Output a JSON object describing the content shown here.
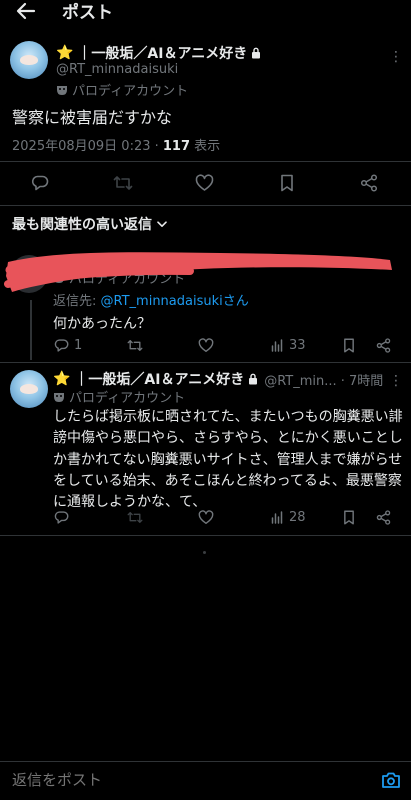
{
  "header": {
    "title": "ポスト",
    "back_icon": "arrow-left-icon"
  },
  "main_post": {
    "star": "⭐",
    "display_name": "｜一般垢／AI＆アニメ好き",
    "handle": "@RT_minnadaisuki",
    "label": "パロディアカウント",
    "text": "警察に被害届だすかな",
    "datetime": "2025年08月09日 0:23 · ",
    "views_count": "117",
    "views_label": " 表示"
  },
  "sort_label": "最も関連性の高い返信",
  "reply1": {
    "label": "パロディアカウント",
    "reply_to_prefix": "返信先: ",
    "reply_to_handle": "@RT_minnadaisukiさん",
    "text": "何かあったん？",
    "reply_count": "1",
    "views": "33"
  },
  "reply2": {
    "star": "⭐",
    "display_name": "｜一般垢／AI＆アニメ好き",
    "handle_time": "@RT_min... · 7時間",
    "label": "パロディアカウント",
    "text": "したらば掲示板に晒されてた、またいつもの胸糞悪い誹謗中傷やら悪口やら、さらすやら、とにかく悪いことしか書かれてない胸糞悪いサイトさ、管理人まで嫌がらせをしている始末、あそこほんと終わってるよ、最悪警察に通報しようかな、て、",
    "views": "28"
  },
  "compose": {
    "placeholder": "返信をポスト"
  },
  "colors": {
    "accent": "#1d9bf0",
    "muted": "#71767b",
    "redaction": "#e8545a",
    "star": "#f5c518"
  }
}
